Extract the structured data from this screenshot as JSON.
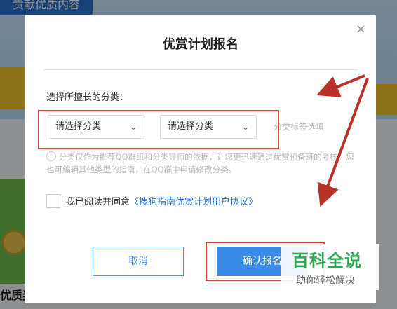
{
  "background": {
    "banner_tag": "贡献优质内容",
    "bottom_text": "优质奖"
  },
  "modal": {
    "title": "优赏计划报名",
    "close_label": "×",
    "category_label": "选择所擅长的分类：",
    "select1": {
      "value": "请选择分类"
    },
    "select2": {
      "value": "请选择分类"
    },
    "tag_hint": "分类标签选填",
    "description": "分类仅作为推荐QQ群组和分类导师的依据，让您更迅速通过优赏预备班的考核。您也可编辑其他类型的指南，在QQ群中申请修改分类。",
    "agree_prefix": "我已阅读并同意",
    "agree_link": "《搜狗指南优赏计划用户协议》",
    "cancel_label": "取消",
    "confirm_label": "确认报名"
  },
  "watermark": {
    "title": "百科全说",
    "subtitle": "助你轻松解决"
  },
  "colors": {
    "primary": "#3a8be8",
    "annotation_red": "#d9453a",
    "watermark_green": "#32a852"
  },
  "icons": {
    "close": "close-icon",
    "chevron": "chevron-down-icon",
    "info": "info-icon"
  }
}
